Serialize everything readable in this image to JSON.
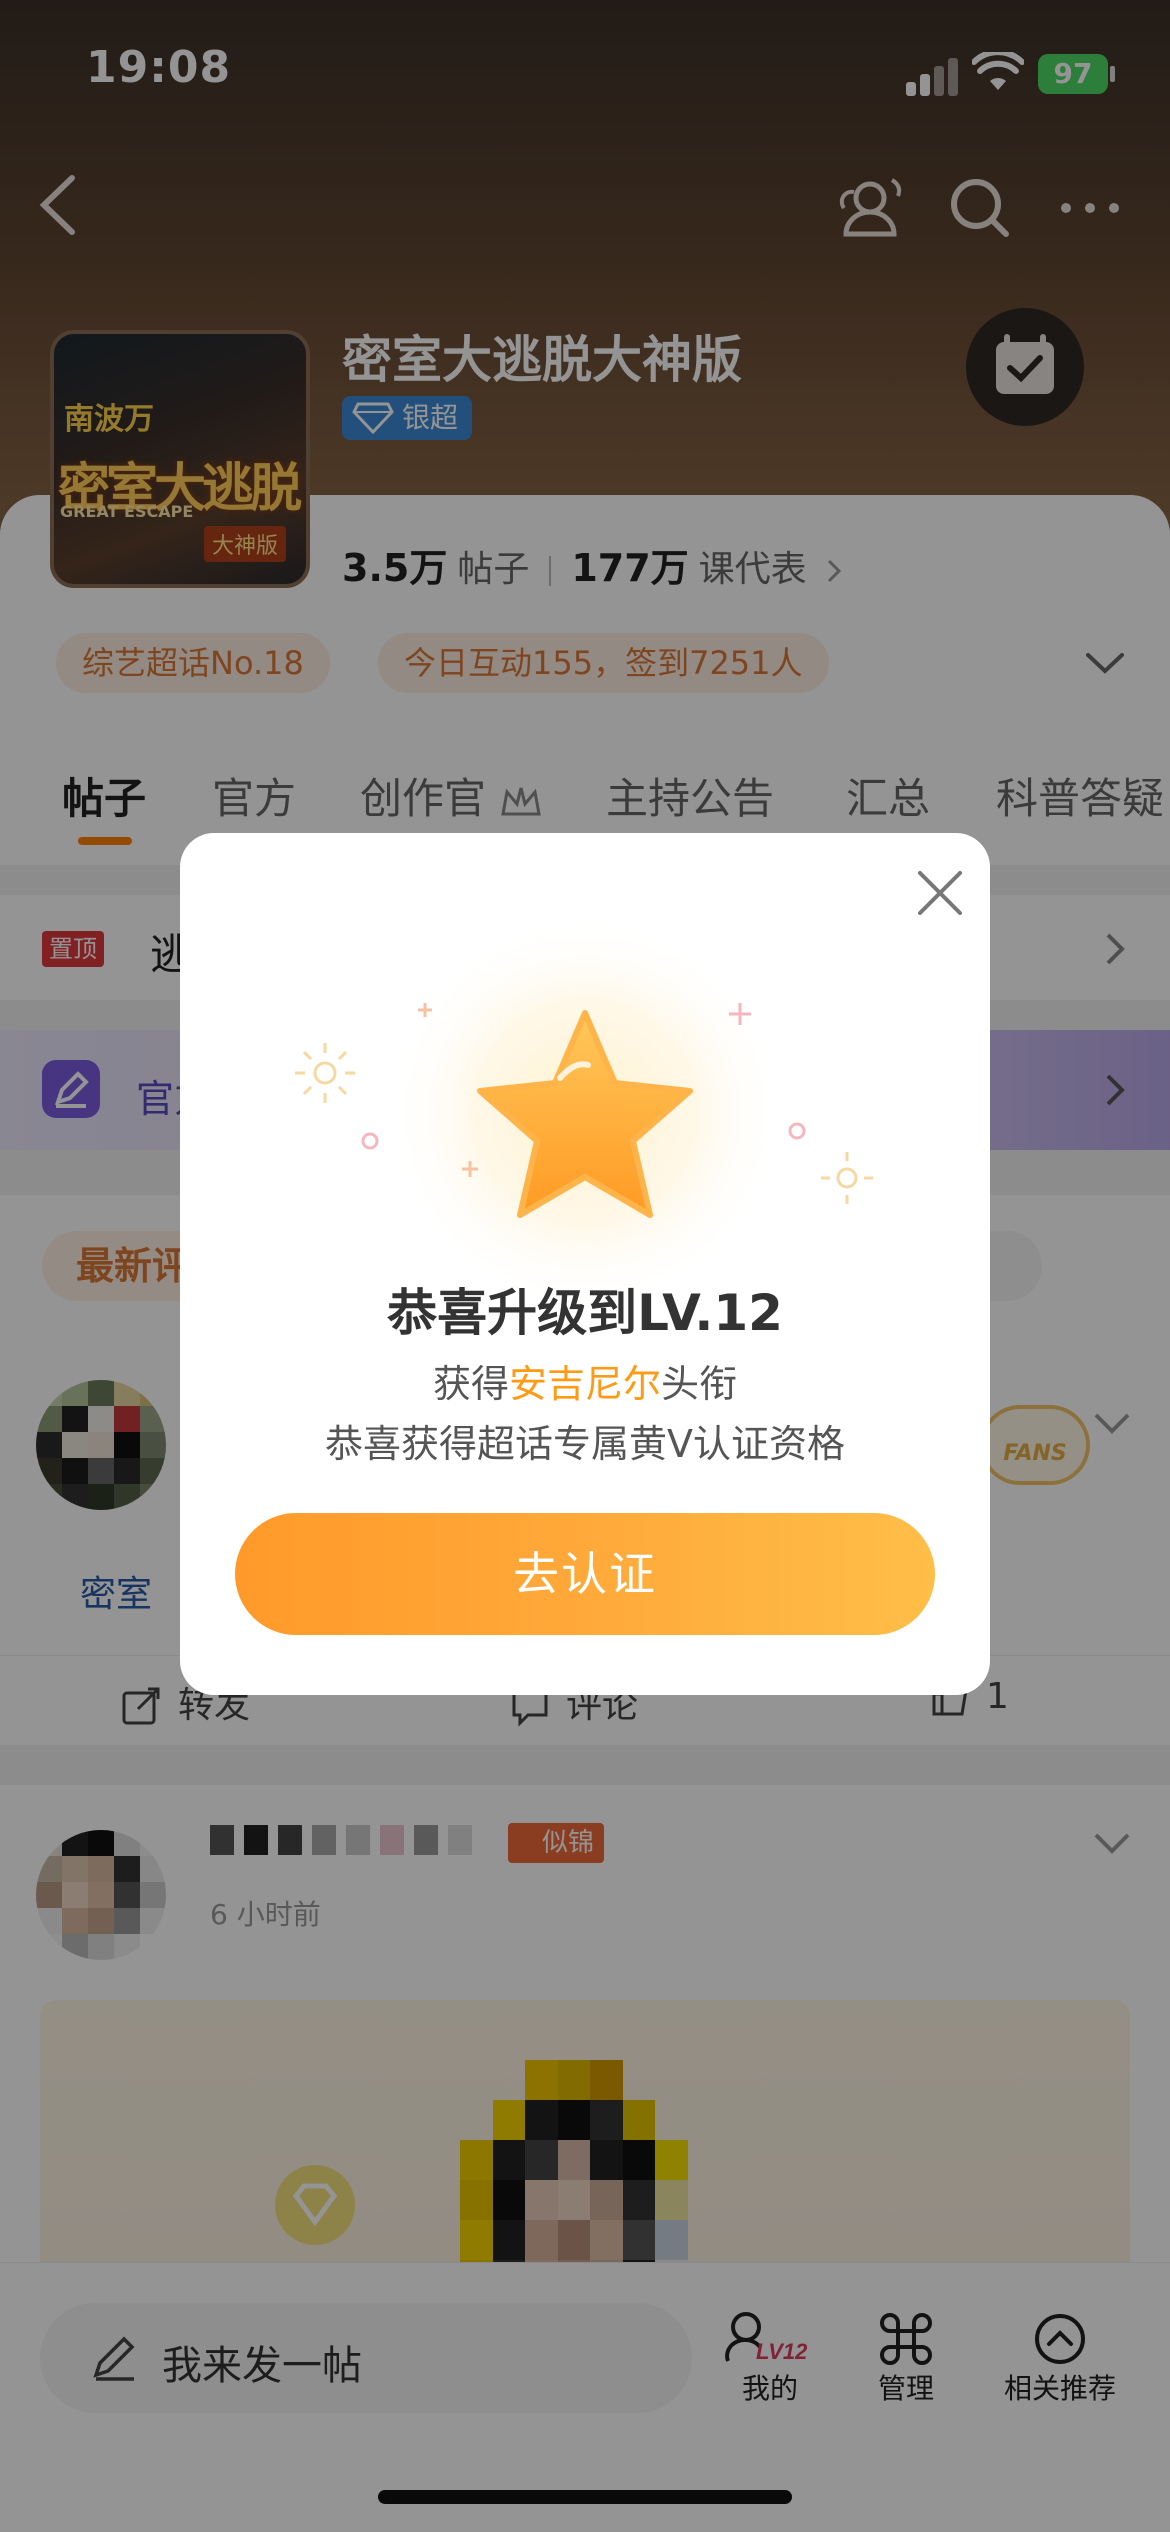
{
  "status_bar": {
    "time": "19:08",
    "battery": "97"
  },
  "topic": {
    "title": "密室大逃脱大神版",
    "badge": "银超",
    "cover": {
      "tag": "南波万",
      "main": "密室大逃脱",
      "sub": "GREAT ESCAPE",
      "badge": "大神版"
    },
    "stats": {
      "posts_value": "3.5万",
      "posts_label": "帖子",
      "reps_value": "177万",
      "reps_label": "课代表"
    },
    "rank_chip": "综艺超话No.18",
    "today_chip": "今日互动155，签到7251人"
  },
  "tabs": [
    "帖子",
    "官方",
    "创作官",
    "主持公告",
    "汇总",
    "科普答疑"
  ],
  "pinned": {
    "badge": "置顶",
    "text": "逃"
  },
  "official": {
    "text": "官方"
  },
  "filter": {
    "label": "最新评"
  },
  "post1": {
    "text": "密室",
    "repost": "转发",
    "comment": "评论",
    "likes": "1",
    "fans_badge": "FANS"
  },
  "post2": {
    "tag": "似锦",
    "meta": "6 小时前"
  },
  "bottom": {
    "compose": "我来发一帖",
    "mine": "我的",
    "level_badge": "LV12",
    "manage": "管理",
    "related": "相关推荐"
  },
  "modal": {
    "title": "恭喜升级到LV.12",
    "line1_prefix": "获得",
    "line1_highlight": "安吉尼尔",
    "line1_suffix": "头衔",
    "line2": "恭喜获得超话专属黄V认证资格",
    "button": "去认证"
  },
  "colors": {
    "accent": "#ff8200",
    "modal_button": "#ffa93a",
    "highlight": "#ff9a14",
    "pin": "#e0393d"
  }
}
